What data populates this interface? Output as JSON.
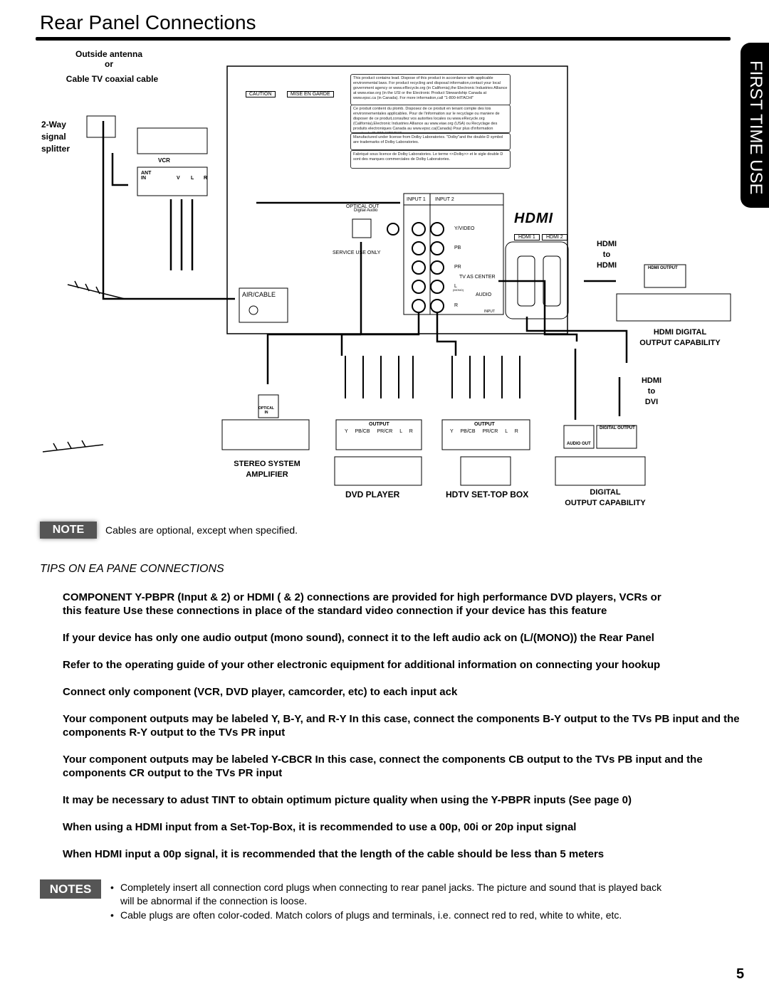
{
  "page": {
    "title": "Rear Panel Connections",
    "side_tab": "FIRST TIME USE",
    "page_number": "5"
  },
  "diagram": {
    "antenna_label": [
      "Outside antenna",
      "or",
      "Cable TV coaxial cable"
    ],
    "splitter_label": [
      "2-Way",
      "signal",
      "splitter"
    ],
    "vcr": {
      "name": "VCR",
      "ant_in": "ANT\nIN",
      "jacks": [
        "V",
        "L",
        "R"
      ]
    },
    "caution": [
      "CAUTION",
      "MISE EN GARDE"
    ],
    "disposal_text": "This product contains lead. Dispose of this product in accordance with applicable environmental laws. For product recycling and disposal information,contact your local government agency or www.eRecycle.org (in California),the Electronic Industries Alliance at www.eiae.org (in the USI or the Electronic Product Stewardship Canada at www.epsc.ca (in Canada). For more information,call \"1-800-HITACHI\"",
    "disposal_text_fr": "Ce produit contient du plomb. Disposez de ce produit en tenant compte des lois environnementales applicables. Pour de l'information sur le recyclage ou maniere de disposer de ce produit,consultez vos autorites locales ou www.eRecycle.org (California),Electronic Industries Alliance au www.eiae.org (USA) ou Recyclage des produits electroniques Canada au www.epsc.ca(Canada) Pour plus d'information appelez le \"1-800-HITACHI\"",
    "dolby_text": "Manufactured under license from Dolby Laboratories. \"Dolby\"and the double-D symbol are trademarks of Dolby Laboratories.",
    "dolby_text_fr": "Fabriqué sous licence de Dolby Laboratories. Le terme <<Dolby>> et le sigle double D sont des marques commerciales de Dolby Laboratories.",
    "optical_out": "OPTICAL OUT",
    "digital_audio": "Digital Audio",
    "service_use_only": "SERVICE USE ONLY",
    "air_cable": "AIR/CABLE",
    "inputs": [
      "INPUT 1",
      "INPUT 2"
    ],
    "jack_labels": [
      "Y/VIDEO",
      "PB",
      "PR",
      "TV AS CENTER",
      "L",
      "(MONO)",
      "AUDIO",
      "R",
      "INPUT"
    ],
    "hdmi_logo": "HDMI",
    "hdmi_ports": [
      "HDMI 1",
      "HDMI 2"
    ],
    "hdmi_to_hdmi": [
      "HDMI",
      "to",
      "HDMI"
    ],
    "hdmi_output": "HDMI OUTPUT",
    "hdmi_digital": [
      "HDMI DIGITAL",
      "OUTPUT CAPABILITY"
    ],
    "hdmi_to_dvi": [
      "HDMI",
      "to",
      "DVI"
    ],
    "digital_output": "DIGITAL OUTPUT",
    "audio_out": "AUDIO OUT",
    "digital_capability": [
      "DIGITAL",
      "OUTPUT CAPABILITY"
    ],
    "optical_in": "OPTICAL\nIN",
    "stereo": [
      "STEREO SYSTEM",
      "AMPLIFIER"
    ],
    "output": "OUTPUT",
    "component_jacks": [
      "Y",
      "PB/CB",
      "PR/CR",
      "L",
      "R"
    ],
    "dvd_player": "DVD PLAYER",
    "hdtv_box": "HDTV SET-TOP BOX"
  },
  "note": {
    "badge": "NOTE",
    "text": "Cables are optional, except when specified."
  },
  "tips": {
    "title": "TIPS ON EA PANE CONNECTIONS",
    "items": [
      [
        "COMPONENT Y-PBPR (Input  & 2) or HDMI ( & 2) connections are provided for high performance DVD players, VCRs or",
        "this feature Use these connections in place of the standard video connection if your device has this feature"
      ],
      [
        "If your device has only one audio output (mono sound), connect it to the left audio ack on (L/(MONO)) the Rear Panel"
      ],
      [
        "Refer to the operating guide of your other electronic equipment for additional information on connecting your hookup"
      ],
      [
        "Connect only  component (VCR, DVD player, camcorder, etc) to each input ack"
      ],
      [
        "Your component outputs may be labeled Y, B-Y, and R-Y In this case, connect the components B-Y output to the TVs PB input and the",
        "components R-Y output to the TVs PR input"
      ],
      [
        "Your component outputs may be labeled Y-CBCR In this case, connect the components CB output to the TVs PB input and the",
        "components CR output to the TVs PR input"
      ],
      [
        "It may be necessary to adust TINT to obtain optimum picture quality when using the Y-PBPR inputs (See page 0)"
      ],
      [
        "When using a HDMI input from a Set-Top-Box, it is recommended to use a 00p, 00i or 20p input signal"
      ],
      [
        "When HDMI input a 00p signal, it is recommended that the length of the cable should be less than 5 meters"
      ]
    ]
  },
  "notes": {
    "badge": "NOTES",
    "items": [
      [
        "Completely insert all connection cord plugs when connecting to rear panel jacks. The picture and sound that is played back",
        "will be abnormal if the connection is loose."
      ],
      [
        "Cable plugs are often color-coded. Match colors of plugs and terminals, i.e. connect red to red, white to white, etc."
      ]
    ]
  }
}
